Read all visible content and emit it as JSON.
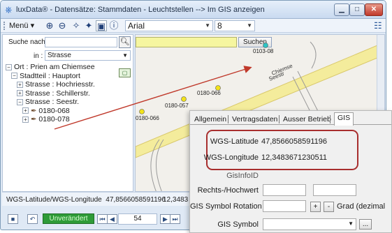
{
  "window": {
    "title": "luxData® - Datensätze: Stammdaten - Leuchtstellen --> Im GIS anzeigen",
    "min_glyph": "▁",
    "max_glyph": "□",
    "close_glyph": "✕"
  },
  "toolbar": {
    "menu_label": "Menü",
    "menu_arrow": "▾",
    "font": "Arial",
    "font_size": "8"
  },
  "left": {
    "search_label": "Suche nach :",
    "search_value": "",
    "in_label": "in :",
    "in_value": "Strasse",
    "tree": [
      {
        "toggle": "⊟",
        "text": "Ort : Prien am Chiemsee",
        "level": 0
      },
      {
        "toggle": "⊟",
        "text": "Stadtteil : Hauptort",
        "level": 1
      },
      {
        "toggle": "⊞",
        "text": "Strasse : Hochriesstr.",
        "level": 2
      },
      {
        "toggle": "⊞",
        "text": "Strasse : Schillerstr.",
        "level": 2
      },
      {
        "toggle": "⊟",
        "text": "Strasse : Seestr.",
        "level": 2
      },
      {
        "toggle": "⊞",
        "text": "0180-068",
        "level": 3
      },
      {
        "toggle": "⊞",
        "text": "0180-078",
        "level": 3
      }
    ]
  },
  "map": {
    "search_button": "Suchen",
    "search_value": "",
    "street_label": "Chiemse",
    "street_label_2": "Seestr",
    "points": [
      {
        "label": "0103-08",
        "color": "#2ec4c4"
      },
      {
        "label": "0180-066",
        "color": "#f2e21a"
      },
      {
        "label": "0180-057",
        "color": "#f2e21a"
      },
      {
        "label": "0180-066",
        "color": "#f2e21a"
      }
    ]
  },
  "statusbar": {
    "label": "WGS-Latitude/WGS-Longitude",
    "value1": "47,8566058591196",
    "value2": "12,3483"
  },
  "navbar": {
    "status": "Unverändert",
    "page": "54"
  },
  "gis_panel": {
    "tabs": [
      "Allgemein",
      "Vertragsdaten",
      "Ausser Betrieb",
      "GIS"
    ],
    "active_tab": "GIS",
    "fields": {
      "lat_label": "WGS-Latitude",
      "lat_value": "47,8566058591196",
      "lon_label": "WGS-Longitude",
      "lon_value": "12,3483671230511",
      "gisinfoid_label": "GisInfoID",
      "rechts_label": "Rechts-/Hochwert",
      "rotation_label": "GIS Symbol Rotation",
      "rotation_unit": "Grad (dezimal",
      "plus_label": "+",
      "minus_label": "-",
      "symbol_label": "GIS Symbol",
      "symbol_button": "..."
    },
    "highlight_color": "#a82e2e"
  }
}
